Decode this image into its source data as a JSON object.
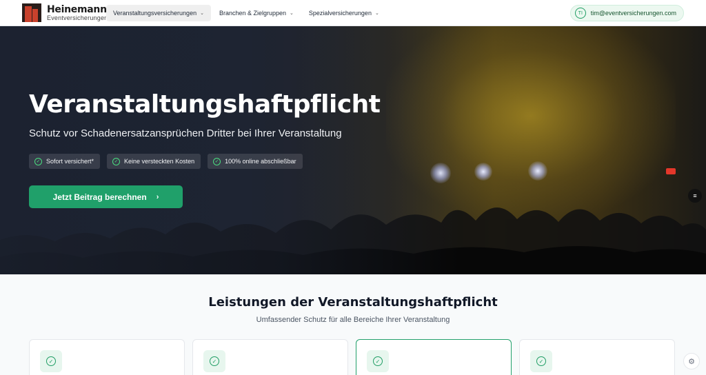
{
  "header": {
    "logo_name": "Heinemann",
    "logo_sub": "Eventversicherungen",
    "nav": [
      {
        "label": "Veranstaltungsversicherungen",
        "active": true
      },
      {
        "label": "Branchen & Zielgruppen",
        "active": false
      },
      {
        "label": "Spezialversicherungen",
        "active": false
      }
    ],
    "user_initials": "TI",
    "user_email": "tim@eventversicherungen.com"
  },
  "hero": {
    "title": "Veranstaltungshaftpflicht",
    "subtitle": "Schutz vor Schadenersatzansprüchen Dritter bei Ihrer Veranstaltung",
    "badges": [
      "Sofort versichert*",
      "Keine versteckten Kosten",
      "100% online abschließbar"
    ],
    "cta_label": "Jetzt Beitrag berechnen"
  },
  "section": {
    "title": "Leistungen der Veranstaltungshaftpflicht",
    "subtitle": "Umfassender Schutz für alle Bereiche Ihrer Veranstaltung"
  },
  "colors": {
    "accent": "#20a06a",
    "hero_dark": "#1c2433",
    "brand_red": "#c8412c"
  },
  "icons": [
    "chevron-down-icon",
    "check-circle-icon",
    "chevron-right-icon",
    "gear-icon",
    "filter-icon"
  ]
}
